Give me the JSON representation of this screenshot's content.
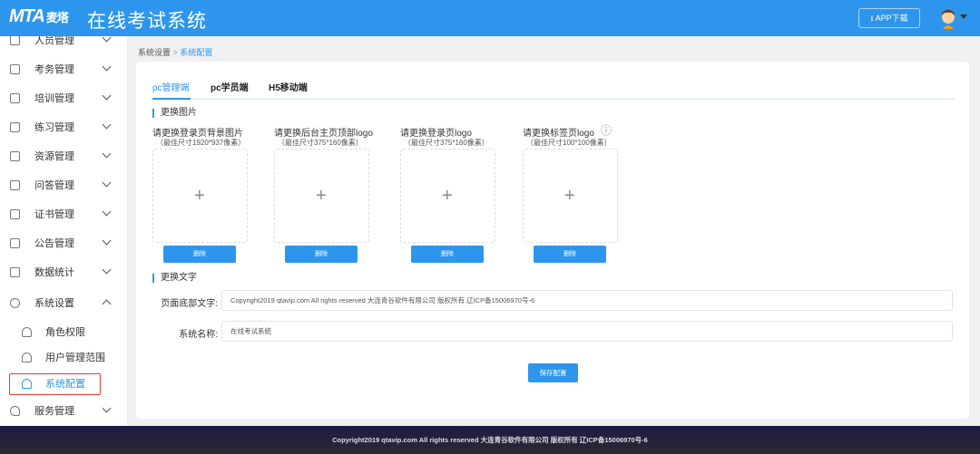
{
  "header": {
    "logo_text": "MTA",
    "logo_cn": "麦塔",
    "title": "在线考试系统",
    "app_download": "APP下载"
  },
  "sidebar": {
    "items": [
      {
        "label": "人员管理",
        "icon": "user-icon"
      },
      {
        "label": "考务管理",
        "icon": "exam-icon"
      },
      {
        "label": "培训管理",
        "icon": "book-icon"
      },
      {
        "label": "练习管理",
        "icon": "edit-icon"
      },
      {
        "label": "资源管理",
        "icon": "resource-icon"
      },
      {
        "label": "问答管理",
        "icon": "chat-icon"
      },
      {
        "label": "证书管理",
        "icon": "certificate-icon"
      },
      {
        "label": "公告管理",
        "icon": "announcement-icon"
      },
      {
        "label": "数据统计",
        "icon": "chart-icon"
      },
      {
        "label": "系统设置",
        "icon": "shield-icon"
      }
    ],
    "sub_items": [
      {
        "label": "角色权限"
      },
      {
        "label": "用户管理范围"
      },
      {
        "label": "系统配置"
      }
    ],
    "last_item": {
      "label": "服务管理",
      "icon": "heart-icon"
    }
  },
  "breadcrumb": {
    "parent": "系统设置",
    "separator": ">",
    "current": "系统配置"
  },
  "tabs": [
    {
      "label": "pc管理端"
    },
    {
      "label": "pc学员端"
    },
    {
      "label": "H5移动端"
    }
  ],
  "section_images": "更换图片",
  "uploads": [
    {
      "title": "请更换登录页背景图片",
      "hint": "（最佳尺寸1920*937像素）",
      "delete": "删除"
    },
    {
      "title": "请更换后台主页顶部logo",
      "hint": "（最佳尺寸375*160像素）",
      "delete": "删除"
    },
    {
      "title": "请更换登录页logo",
      "hint": "（最佳尺寸375*160像素）",
      "delete": "删除"
    },
    {
      "title": "请更换标签页logo",
      "hint": "（最佳尺寸100*100像素）",
      "delete": "删除"
    }
  ],
  "info_glyph": "ⓘ",
  "plus_glyph": "+",
  "section_text": "更换文字",
  "fields": [
    {
      "label": "页面底部文字:",
      "value": "Copyright2019 qtavip.com All rights reserved 大连青谷软件有限公司 版权所有 辽ICP备15006970号-6"
    },
    {
      "label": "系统名称:",
      "value": "在线考试系统"
    }
  ],
  "save": "保存配置",
  "footer": "Copyright2019 qtavip.com All rights reserved 大连青谷软件有限公司 版权所有 辽ICP备15006970号-6"
}
